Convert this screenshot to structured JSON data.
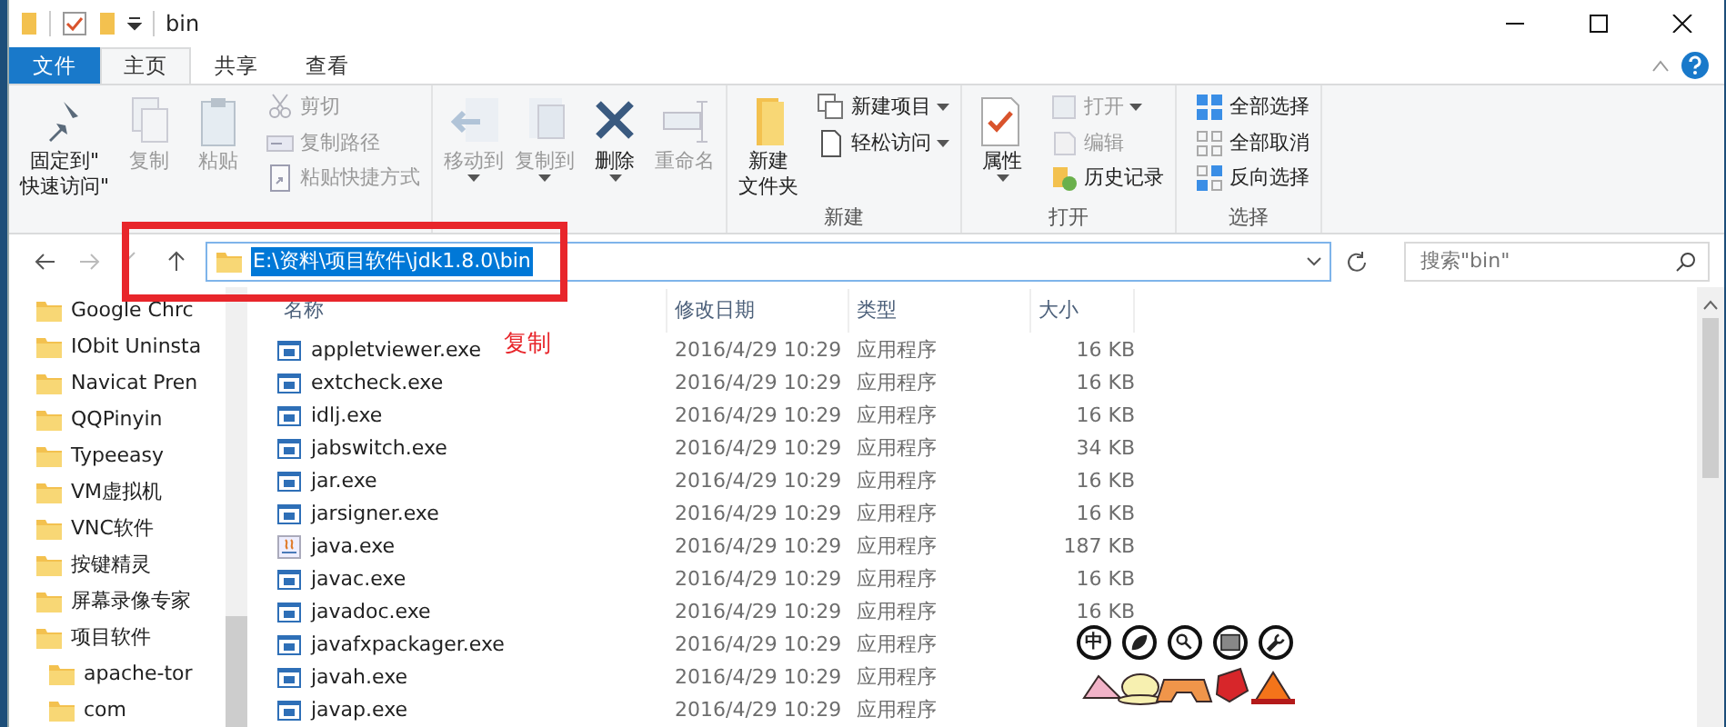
{
  "window": {
    "title": "bin"
  },
  "tabs": [
    {
      "label": "文件",
      "kind": "file",
      "selected": false
    },
    {
      "label": "主页",
      "kind": "tab",
      "selected": true
    },
    {
      "label": "共享",
      "kind": "tab",
      "selected": false
    },
    {
      "label": "查看",
      "kind": "tab",
      "selected": false
    }
  ],
  "ribbon": {
    "groups": [
      {
        "items": [
          {
            "kind": "large",
            "lines": [
              "固定到\"",
              "快速访问\""
            ],
            "disabled": false,
            "dropdown": false
          },
          {
            "kind": "large",
            "lines": [
              "复制"
            ],
            "disabled": true,
            "dropdown": false
          },
          {
            "kind": "large",
            "lines": [
              "粘贴"
            ],
            "disabled": true,
            "dropdown": false
          },
          {
            "kind": "small",
            "lines": [
              "剪切"
            ],
            "disabled": true,
            "dropdown": false
          },
          {
            "kind": "small",
            "lines": [
              "复制路径"
            ],
            "disabled": true,
            "dropdown": false
          },
          {
            "kind": "small",
            "lines": [
              "粘贴快捷方式"
            ],
            "disabled": true,
            "dropdown": false
          }
        ]
      },
      {
        "items": [
          {
            "kind": "large",
            "lines": [
              "移动到"
            ],
            "disabled": true,
            "dropdown": true
          },
          {
            "kind": "large",
            "lines": [
              "复制到"
            ],
            "disabled": true,
            "dropdown": true
          },
          {
            "kind": "large",
            "lines": [
              "删除"
            ],
            "disabled": false,
            "dropdown": true
          },
          {
            "kind": "large",
            "lines": [
              "重命名"
            ],
            "disabled": true,
            "dropdown": false
          }
        ]
      },
      {
        "label": "新建",
        "items": [
          {
            "kind": "large",
            "lines": [
              "新建",
              "文件夹"
            ],
            "disabled": false,
            "dropdown": false
          },
          {
            "kind": "small",
            "lines": [
              "新建项目"
            ],
            "disabled": false,
            "dropdown": true
          },
          {
            "kind": "small",
            "lines": [
              "轻松访问"
            ],
            "disabled": false,
            "dropdown": true
          }
        ]
      },
      {
        "label": "打开",
        "items": [
          {
            "kind": "large",
            "lines": [
              "属性"
            ],
            "disabled": false,
            "dropdown": true
          },
          {
            "kind": "small",
            "lines": [
              "打开"
            ],
            "disabled": true,
            "dropdown": true
          },
          {
            "kind": "small",
            "lines": [
              "编辑"
            ],
            "disabled": true,
            "dropdown": false
          },
          {
            "kind": "small",
            "lines": [
              "历史记录"
            ],
            "disabled": false,
            "dropdown": false
          }
        ]
      },
      {
        "label": "选择",
        "items": [
          {
            "kind": "small",
            "lines": [
              "全部选择"
            ],
            "disabled": false,
            "dropdown": false
          },
          {
            "kind": "small",
            "lines": [
              "全部取消"
            ],
            "disabled": false,
            "dropdown": false
          },
          {
            "kind": "small",
            "lines": [
              "反向选择"
            ],
            "disabled": false,
            "dropdown": false
          }
        ]
      }
    ]
  },
  "address": {
    "path": "E:\\资料\\项目软件\\jdk1.8.0\\bin",
    "selected": true
  },
  "search": {
    "placeholder": "搜索\"bin\""
  },
  "nav": [
    {
      "label": "Google Chrc"
    },
    {
      "label": "IObit Uninsta"
    },
    {
      "label": "Navicat Pren"
    },
    {
      "label": "QQPinyin"
    },
    {
      "label": "Typeeasy"
    },
    {
      "label": "VM虚拟机"
    },
    {
      "label": "VNC软件"
    },
    {
      "label": "按键精灵"
    },
    {
      "label": "屏幕录像专家"
    },
    {
      "label": "项目软件",
      "children": [
        {
          "label": "apache-tor"
        },
        {
          "label": "com"
        }
      ]
    }
  ],
  "table": {
    "columns": [
      "名称",
      "修改日期",
      "类型",
      "大小"
    ],
    "rows": [
      {
        "name": "appletviewer.exe",
        "kind": "app",
        "date": "2016/4/29 10:29",
        "type": "应用程序",
        "size": "16 KB"
      },
      {
        "name": "extcheck.exe",
        "kind": "app",
        "date": "2016/4/29 10:29",
        "type": "应用程序",
        "size": "16 KB"
      },
      {
        "name": "idlj.exe",
        "kind": "app",
        "date": "2016/4/29 10:29",
        "type": "应用程序",
        "size": "16 KB"
      },
      {
        "name": "jabswitch.exe",
        "kind": "app",
        "date": "2016/4/29 10:29",
        "type": "应用程序",
        "size": "34 KB"
      },
      {
        "name": "jar.exe",
        "kind": "app",
        "date": "2016/4/29 10:29",
        "type": "应用程序",
        "size": "16 KB"
      },
      {
        "name": "jarsigner.exe",
        "kind": "app",
        "date": "2016/4/29 10:29",
        "type": "应用程序",
        "size": "16 KB"
      },
      {
        "name": "java.exe",
        "kind": "java",
        "date": "2016/4/29 10:29",
        "type": "应用程序",
        "size": "187 KB"
      },
      {
        "name": "javac.exe",
        "kind": "app",
        "date": "2016/4/29 10:29",
        "type": "应用程序",
        "size": "16 KB"
      },
      {
        "name": "javadoc.exe",
        "kind": "app",
        "date": "2016/4/29 10:29",
        "type": "应用程序",
        "size": "16 KB"
      },
      {
        "name": "javafxpackager.exe",
        "kind": "app",
        "date": "2016/4/29 10:29",
        "type": "应用程序"
      },
      {
        "name": "javah.exe",
        "kind": "app",
        "date": "2016/4/29 10:29",
        "type": "应用程序"
      },
      {
        "name": "javap.exe",
        "kind": "app",
        "date": "2016/4/29 10:29",
        "type": "应用程序"
      }
    ]
  },
  "annotation": {
    "text": "复制"
  },
  "ime_toolbar": {
    "mode": "中"
  }
}
